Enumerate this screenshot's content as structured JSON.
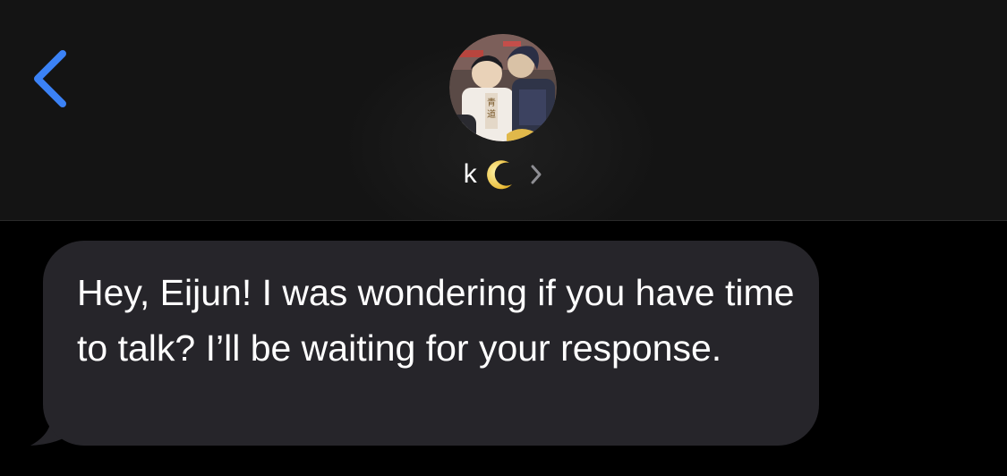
{
  "colors": {
    "header_bg": "#141414",
    "screen_bg": "#000000",
    "accent_blue": "#3b82f6",
    "bubble_bg": "#26252a",
    "text": "#ffffff",
    "chevron": "#8e8e93"
  },
  "header": {
    "back_icon": "chevron-left-icon",
    "contact": {
      "name": "k",
      "emoji_icon": "crescent-moon-icon",
      "disclosure_icon": "chevron-right-icon",
      "avatar": "contact-avatar-photo"
    }
  },
  "thread": {
    "messages": [
      {
        "direction": "incoming",
        "text": "Hey, Eijun! I was wondering if you have time to talk? I’ll be waiting for your response."
      }
    ]
  }
}
